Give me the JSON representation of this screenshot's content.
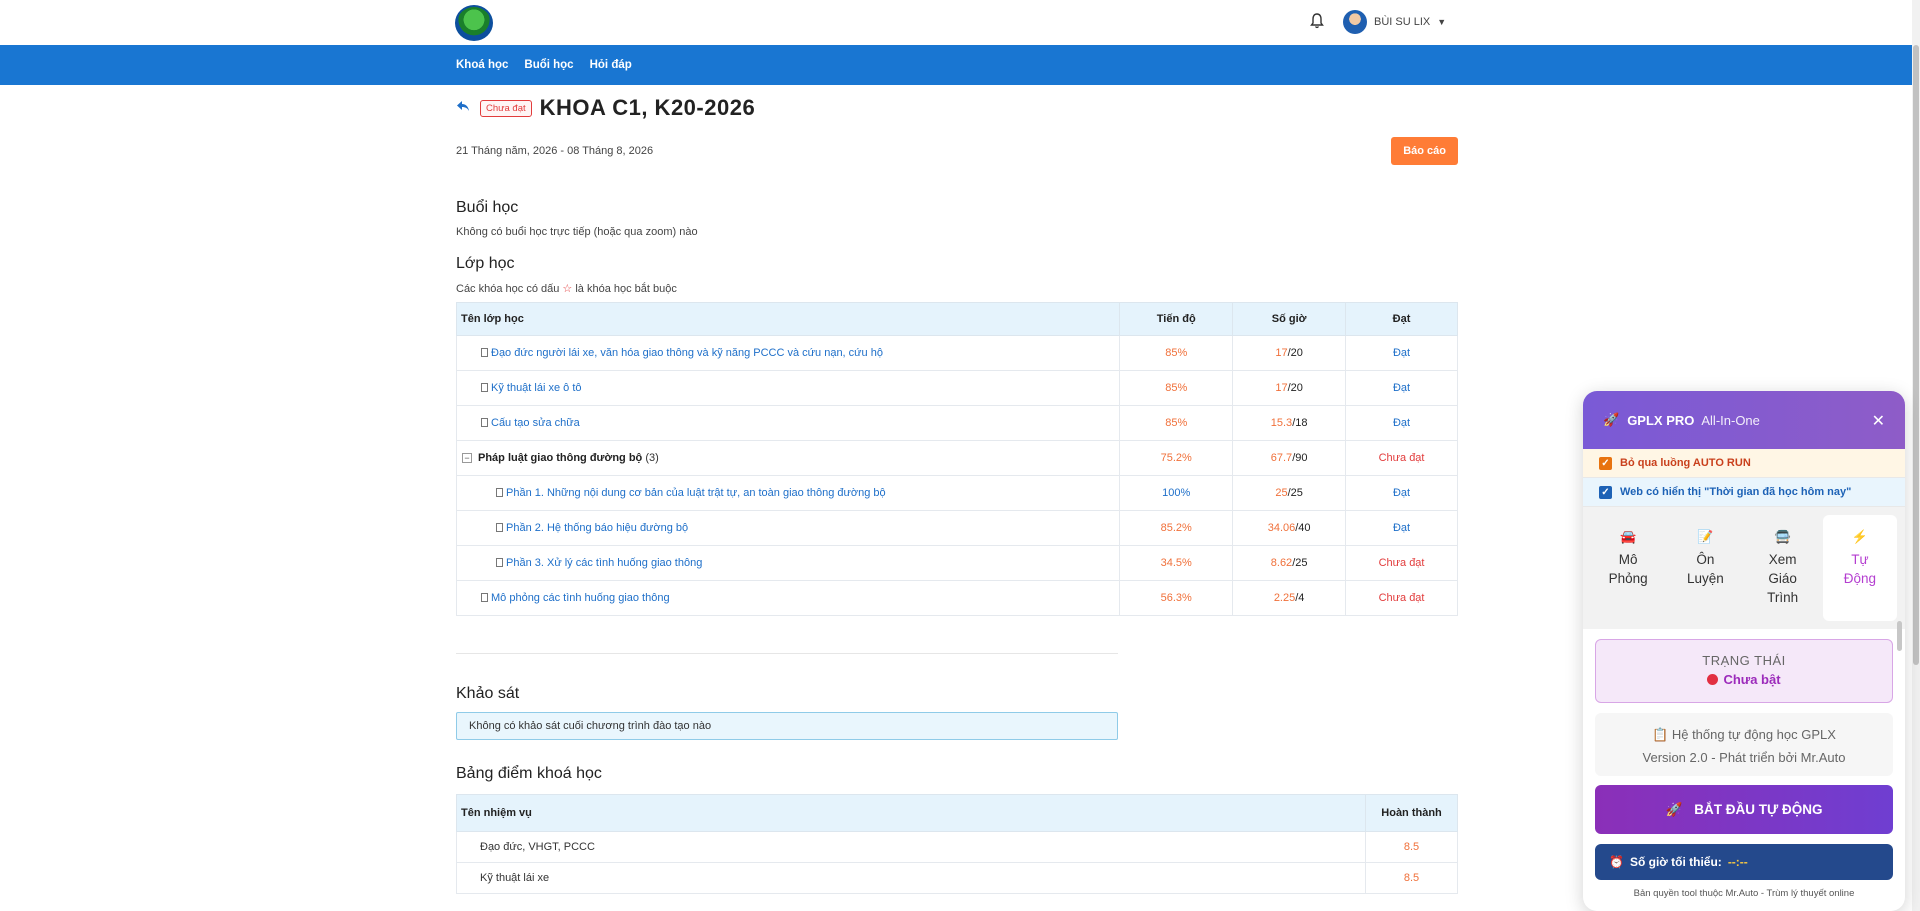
{
  "header": {
    "user_name": "BÙI SU LIX"
  },
  "nav": {
    "items": [
      "Khoá học",
      "Buổi học",
      "Hỏi đáp"
    ]
  },
  "course": {
    "status_badge": "Chưa đạt",
    "title": "KHOA C1, K20-2026",
    "dates": "21 Tháng năm, 2026 - 08 Tháng 8, 2026",
    "report_button": "Báo cáo"
  },
  "sessions": {
    "heading": "Buổi học",
    "note": "Không có buổi học trực tiếp (hoặc qua zoom) nào"
  },
  "classes": {
    "heading": "Lớp học",
    "note_before": "Các khóa học có dấu",
    "note_after": "là khóa học bắt buộc",
    "columns": [
      "Tên lớp học",
      "Tiến độ",
      "Số giờ",
      "Đạt"
    ],
    "rows": [
      {
        "name": "Đạo đức người lái xe, văn hóa giao thông và kỹ năng PCCC và cứu nạn, cứu hộ",
        "progress": "85%",
        "done": "17",
        "total": "/20",
        "result": "Đạt"
      },
      {
        "name": "Kỹ thuật lái xe ô tô",
        "progress": "85%",
        "done": "17",
        "total": "/20",
        "result": "Đạt"
      },
      {
        "name": "Cấu tạo sửa chữa",
        "progress": "85%",
        "done": "15.3",
        "total": "/18",
        "result": "Đạt"
      },
      {
        "name": "Pháp luật giao thông đường bộ",
        "count": "(3)",
        "progress": "75.2%",
        "done": "67.7",
        "total": "/90",
        "result": "Chưa đạt"
      },
      {
        "name": "Phần 1. Những nội dung cơ bản của luật trật tự, an toàn giao thông đường bộ",
        "progress": "100%",
        "done": "25",
        "total": "/25",
        "result": "Đạt"
      },
      {
        "name": "Phần 2. Hệ thống báo hiệu đường bộ",
        "progress": "85.2%",
        "done": "34.06",
        "total": "/40",
        "result": "Đạt"
      },
      {
        "name": "Phần 3. Xử lý các tình huống giao thông",
        "progress": "34.5%",
        "done": "8.62",
        "total": "/25",
        "result": "Chưa đạt"
      },
      {
        "name": "Mô phỏng các tình huống giao thông",
        "progress": "56.3%",
        "done": "2.25",
        "total": "/4",
        "result": "Chưa đạt"
      }
    ]
  },
  "survey": {
    "heading": "Khảo sát",
    "note": "Không có khảo sát cuối chương trình đào tạo nào"
  },
  "scores": {
    "heading": "Bảng điểm khoá học",
    "columns": [
      "Tên nhiệm vụ",
      "Hoàn thành"
    ],
    "rows": [
      {
        "name": "Đạo đức, VHGT, PCCC",
        "value": "8.5"
      },
      {
        "name": "Kỹ thuật lái xe",
        "value": "8.5"
      }
    ]
  },
  "panel": {
    "name": "GPLX PRO",
    "subtitle": "All-In-One",
    "checkbox_1": "Bỏ qua luồng AUTO RUN",
    "checkbox_2": "Web có hiển thị \"Thời gian đã học hôm nay\"",
    "tabs": [
      {
        "line1": "Mô",
        "line2": "Phỏng",
        "line3": "",
        "icon": "🚘"
      },
      {
        "line1": "Ôn",
        "line2": "Luyện",
        "line3": "",
        "icon": "📝"
      },
      {
        "line1": "Xem",
        "line2": "Giáo",
        "line3": "Trình",
        "icon": "🚍"
      },
      {
        "line1": "Tự",
        "line2": "Động",
        "line3": "",
        "icon": "⚡"
      }
    ],
    "status_label": "TRẠNG THÁI",
    "status_value": "Chưa bật",
    "info_line1": "📋 Hệ thống tự động học GPLX",
    "info_line2": "Version 2.0 - Phát triển bởi Mr.Auto",
    "start_button": "BẮT ĐẦU TỰ ĐỘNG",
    "min_hours_label": "Số giờ tối thiểu:",
    "min_hours_value": "--:--",
    "footer": "Bản quyền tool thuộc Mr.Auto - Trùm lý thuyết online"
  },
  "colors": {
    "nav": "#1976d2",
    "accent_orange": "#ff7c36",
    "panel_purple": "#7a5ad6",
    "fail_red": "#e23c3c"
  }
}
